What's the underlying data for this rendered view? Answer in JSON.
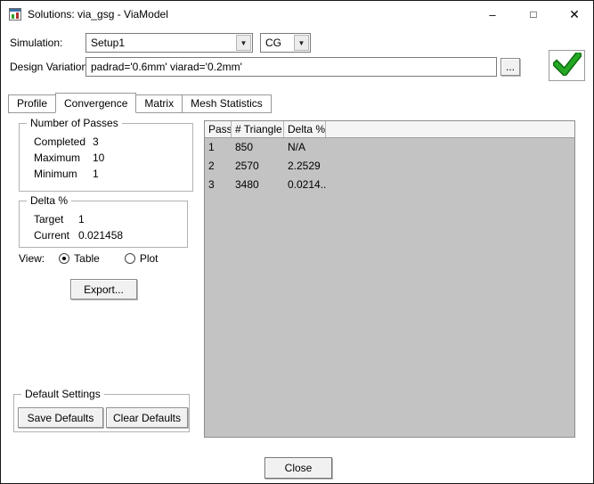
{
  "window": {
    "title": "Solutions: via_gsg - ViaModel",
    "minimize_glyph": "–",
    "maximize_glyph": "□",
    "close_glyph": "✕"
  },
  "simulation": {
    "label": "Simulation:",
    "value": "Setup1"
  },
  "solution_type": {
    "value": "CG"
  },
  "design_variation": {
    "label": "Design Variation:",
    "value": "padrad='0.6mm' viarad='0.2mm'",
    "browse_label": "..."
  },
  "tabs": [
    {
      "label": "Profile",
      "active": false
    },
    {
      "label": "Convergence",
      "active": true
    },
    {
      "label": "Matrix",
      "active": false
    },
    {
      "label": "Mesh Statistics",
      "active": false
    }
  ],
  "passes_group": {
    "title": "Number of Passes",
    "rows": [
      {
        "label": "Completed",
        "value": "3"
      },
      {
        "label": "Maximum",
        "value": "10"
      },
      {
        "label": "Minimum",
        "value": "1"
      }
    ]
  },
  "delta_group": {
    "title": "Delta %",
    "rows": [
      {
        "label": "Target",
        "value": "1"
      },
      {
        "label": "Current",
        "value": "0.021458"
      }
    ]
  },
  "view": {
    "label": "View:",
    "options": [
      {
        "label": "Table",
        "selected": true
      },
      {
        "label": "Plot",
        "selected": false
      }
    ]
  },
  "buttons": {
    "export": "Export...",
    "save_defaults": "Save Defaults",
    "clear_defaults": "Clear Defaults",
    "close": "Close"
  },
  "defaults_group": {
    "title": "Default Settings"
  },
  "table": {
    "columns": [
      "Pass",
      "# Triangle",
      "Delta %"
    ],
    "rows": [
      [
        "1",
        "850",
        "N/A"
      ],
      [
        "2",
        "2570",
        "2.2529"
      ],
      [
        "3",
        "3480",
        "0.0214..."
      ]
    ]
  },
  "colors": {
    "check_green": "#25a825",
    "table_background": "#c3c3c3"
  }
}
